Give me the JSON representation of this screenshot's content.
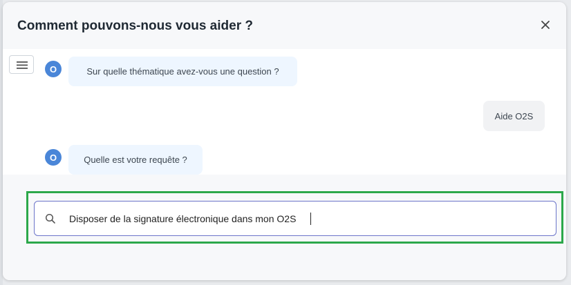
{
  "modal": {
    "title": "Comment pouvons-nous vous aider ?"
  },
  "icons": {
    "close": "close-icon",
    "menu": "hamburger-menu-icon",
    "search": "search-icon"
  },
  "chat": {
    "messages": [
      {
        "sender": "bot",
        "avatar_letter": "O",
        "text": "Sur quelle thématique avez-vous une question ?"
      },
      {
        "sender": "user",
        "text": "Aide O2S"
      },
      {
        "sender": "bot",
        "avatar_letter": "O",
        "text": "Quelle est votre requête ?"
      }
    ]
  },
  "search": {
    "value": "Disposer de la signature électronique dans mon O2S"
  },
  "colors": {
    "avatar": "#4a86d8",
    "bot_bubble": "#eef6ff",
    "user_bubble": "#f1f2f4",
    "highlight": "#2ca84a",
    "input_border": "#6b74c9"
  }
}
